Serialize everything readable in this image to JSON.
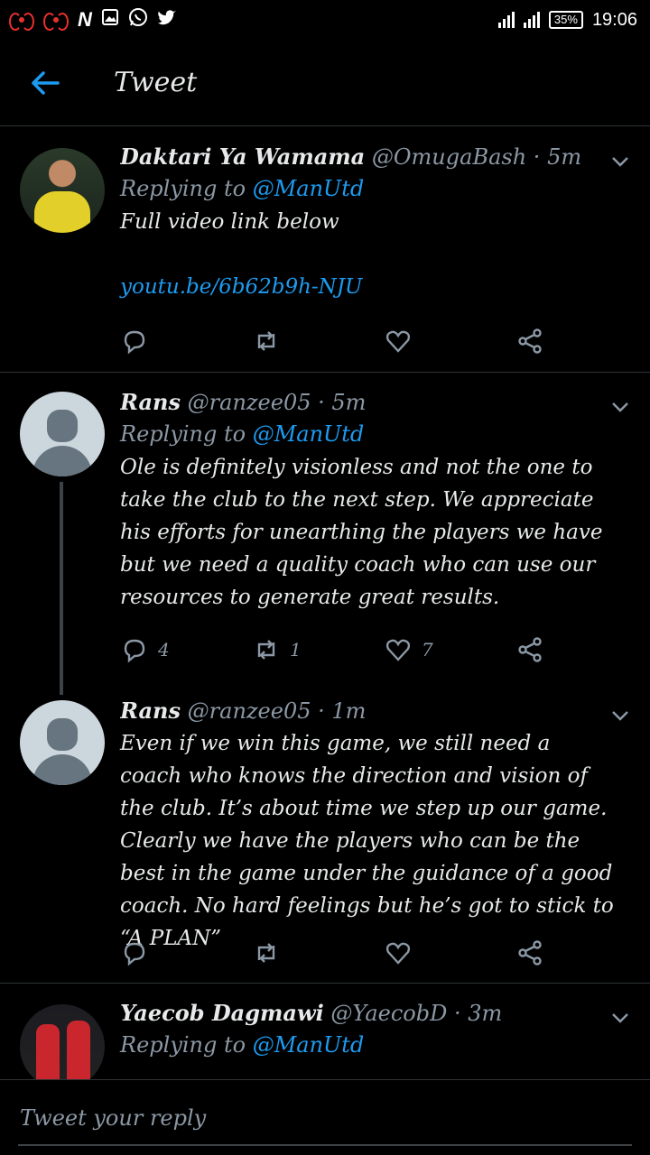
{
  "status_bar": {
    "battery": "35%",
    "time": "19:06"
  },
  "header": {
    "title": "Tweet"
  },
  "tweets": [
    {
      "name": "Daktari Ya Wamama",
      "handle": "@OmugaBash",
      "time": "5m",
      "replying_prefix": "Replying to ",
      "replying_to": "@ManUtd",
      "text": "Full video link below",
      "link": "youtu.be/6b62b9h-NJU",
      "counts": {
        "reply": "",
        "retweet": "",
        "like": ""
      }
    },
    {
      "name": "Rans",
      "handle": "@ranzee05",
      "time": "5m",
      "replying_prefix": "Replying to ",
      "replying_to": "@ManUtd",
      "text": "Ole is definitely visionless and not the one to take the club to the next step. We appreciate his efforts for unearthing the players we have but we need a quality coach who can use our resources to generate great results.",
      "counts": {
        "reply": "4",
        "retweet": "1",
        "like": "7"
      }
    },
    {
      "name": "Rans",
      "handle": "@ranzee05",
      "time": "1m",
      "text": "Even if we win this game, we still need a coach who knows the direction and vision of the club. It’s about time we step up our game. Clearly we have the players who can be the best in the game under the guidance of a good coach. No hard feelings but he’s got to stick to “A PLAN”",
      "counts": {
        "reply": "",
        "retweet": "",
        "like": ""
      }
    },
    {
      "name": "Yaecob Dagmawi",
      "handle": "@YaecobD",
      "time": "3m",
      "replying_prefix": "Replying to ",
      "replying_to": "@ManUtd"
    }
  ],
  "composer": {
    "placeholder": "Tweet your reply"
  },
  "colors": {
    "accent": "#1d9bf0",
    "muted": "#8b98a5",
    "background": "#000000"
  }
}
